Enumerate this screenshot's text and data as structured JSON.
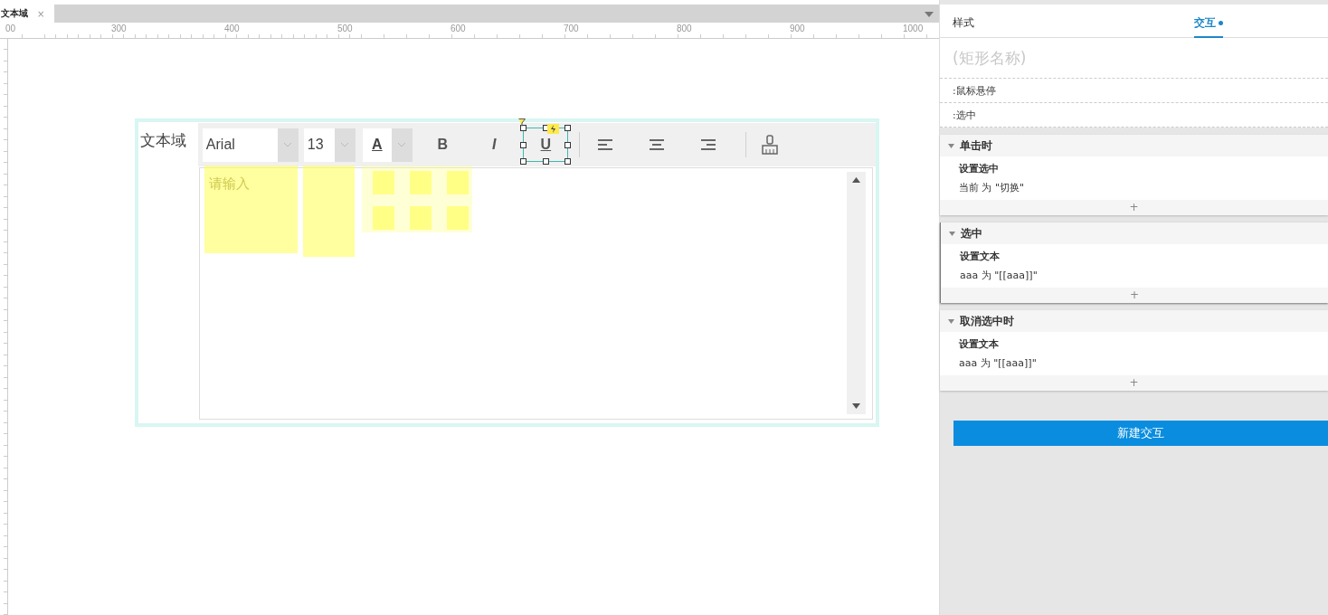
{
  "document_tab": {
    "label": "文本域",
    "close": "×"
  },
  "ruler": {
    "top_labels": [
      "00",
      "300",
      "400",
      "500",
      "600",
      "700",
      "800",
      "900",
      "1000"
    ]
  },
  "widget": {
    "label": "文本域",
    "toolbar": {
      "font": "Arial",
      "size": "13",
      "color_glyph": "A",
      "buttons": [
        {
          "label": "B",
          "kind": "bold",
          "selected": false
        },
        {
          "label": "I",
          "kind": "italic",
          "selected": false
        },
        {
          "label": "U",
          "kind": "underline",
          "selected": true
        }
      ],
      "aligns": [
        {
          "kind": "left"
        },
        {
          "kind": "center"
        },
        {
          "kind": "right"
        }
      ]
    },
    "textarea": {
      "placeholder": "请输入"
    }
  },
  "panel": {
    "tabs": [
      {
        "label": "样式",
        "selected": false,
        "dot": false
      },
      {
        "label": "交互",
        "selected": true,
        "dot": true
      }
    ],
    "name_field": {
      "placeholder": "(矩形名称)"
    },
    "states": [
      ":鼠标悬停",
      ":选中"
    ],
    "events": [
      {
        "title": "单击时",
        "expanded": true,
        "selected": false,
        "actions": [
          {
            "title": "设置选中",
            "detail": "当前 为 \"切换\""
          }
        ],
        "add": "+"
      },
      {
        "title": "选中",
        "expanded": true,
        "selected": true,
        "actions": [
          {
            "title": "设置文本",
            "detail": "aaa 为 \"[[aaa]]\""
          }
        ],
        "add": "+"
      },
      {
        "title": "取消选中时",
        "expanded": true,
        "selected": false,
        "actions": [
          {
            "title": "设置文本",
            "detail": "aaa 为 \"[[aaa]]\""
          }
        ],
        "add": "+"
      }
    ],
    "new_button": "新建交互"
  }
}
